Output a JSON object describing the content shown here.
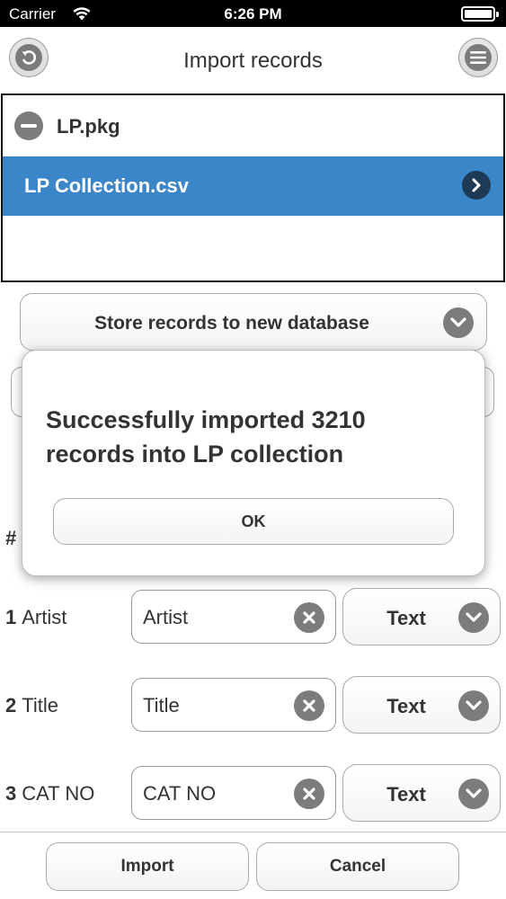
{
  "status_bar": {
    "carrier": "Carrier",
    "time": "6:26 PM"
  },
  "nav": {
    "title": "Import records",
    "back_icon": "undo-arrow-icon",
    "menu_icon": "hamburger-menu-icon"
  },
  "file_list": {
    "package": {
      "name": "LP.pkg",
      "icon": "minus-circle-icon"
    },
    "selected_file": {
      "name": "LP Collection.csv",
      "icon": "chevron-right-icon"
    }
  },
  "store_dropdown": {
    "label": "Store records to new database",
    "icon": "chevron-down-icon"
  },
  "hash_label": "#",
  "fields": [
    {
      "number": "1",
      "name": "Artist",
      "value": "Artist",
      "type": "Text"
    },
    {
      "number": "2",
      "name": "Title",
      "value": "Title",
      "type": "Text"
    },
    {
      "number": "3",
      "name": "CAT NO",
      "value": "CAT NO",
      "type": "Text"
    }
  ],
  "bottom": {
    "import_label": "Import",
    "cancel_label": "Cancel"
  },
  "dialog": {
    "message": "Successfully imported 3210 records into LP collection",
    "ok_label": "OK"
  },
  "colors": {
    "selection": "#3a86c8",
    "chevron_dark": "#1f3a57",
    "icon_gray": "#7c7c7c"
  }
}
